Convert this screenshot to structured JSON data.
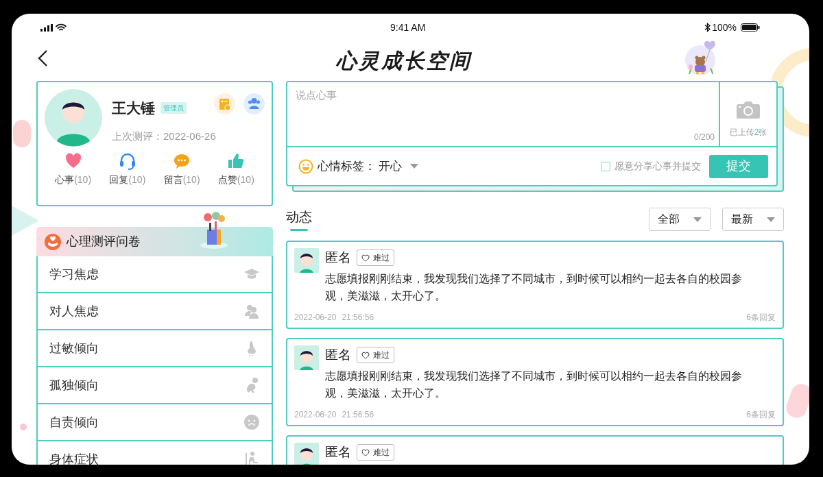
{
  "status_bar": {
    "time": "9:41 AM",
    "battery": "100%"
  },
  "header": {
    "title": "心灵成长空间"
  },
  "profile": {
    "name": "王大锤",
    "badge": "管理员",
    "last_eval": "上次测评：2022-06-26",
    "stats": [
      {
        "kind": "heart",
        "label": "心事",
        "count": "(10)"
      },
      {
        "kind": "headset",
        "label": "回复",
        "count": "(10)"
      },
      {
        "kind": "chat",
        "label": "留言",
        "count": "(10)"
      },
      {
        "kind": "like",
        "label": "点赞",
        "count": "(10)"
      }
    ]
  },
  "survey": {
    "title": "心理测评问卷",
    "items": [
      {
        "kind": "study",
        "label": "学习焦虑"
      },
      {
        "kind": "people",
        "label": "对人焦虑"
      },
      {
        "kind": "nose",
        "label": "过敏倾向"
      },
      {
        "kind": "alone",
        "label": "孤独倾向"
      },
      {
        "kind": "sad",
        "label": "自责倾向"
      },
      {
        "kind": "body",
        "label": "身体症状"
      }
    ]
  },
  "composer": {
    "placeholder": "说点心事",
    "counter": "0/200",
    "upload_before": "已上传",
    "upload_count": "2",
    "upload_after": "张",
    "mood_label": "心情标签：",
    "mood_value": "开心",
    "share_label": "愿意分享心事并提交",
    "share_checked": false,
    "submit": "提交"
  },
  "feed": {
    "title": "动态",
    "filters": [
      {
        "label": "全部"
      },
      {
        "label": "最新"
      }
    ],
    "posts": [
      {
        "name": "匿名",
        "tag": "难过",
        "text": "志愿填报刚刚结束，我发现我们选择了不同城市，到时候可以相约一起去各自的校园参观，美滋滋，太开心了。",
        "date": "2022-06-20",
        "time": "21:56:56",
        "replies": "6条回复"
      },
      {
        "name": "匿名",
        "tag": "难过",
        "text": "志愿填报刚刚结束，我发现我们选择了不同城市，到时候可以相约一起去各自的校园参观，美滋滋，太开心了。",
        "date": "2022-06-20",
        "time": "21:56:56",
        "replies": "6条回复"
      },
      {
        "name": "匿名",
        "tag": "难过"
      }
    ]
  }
}
